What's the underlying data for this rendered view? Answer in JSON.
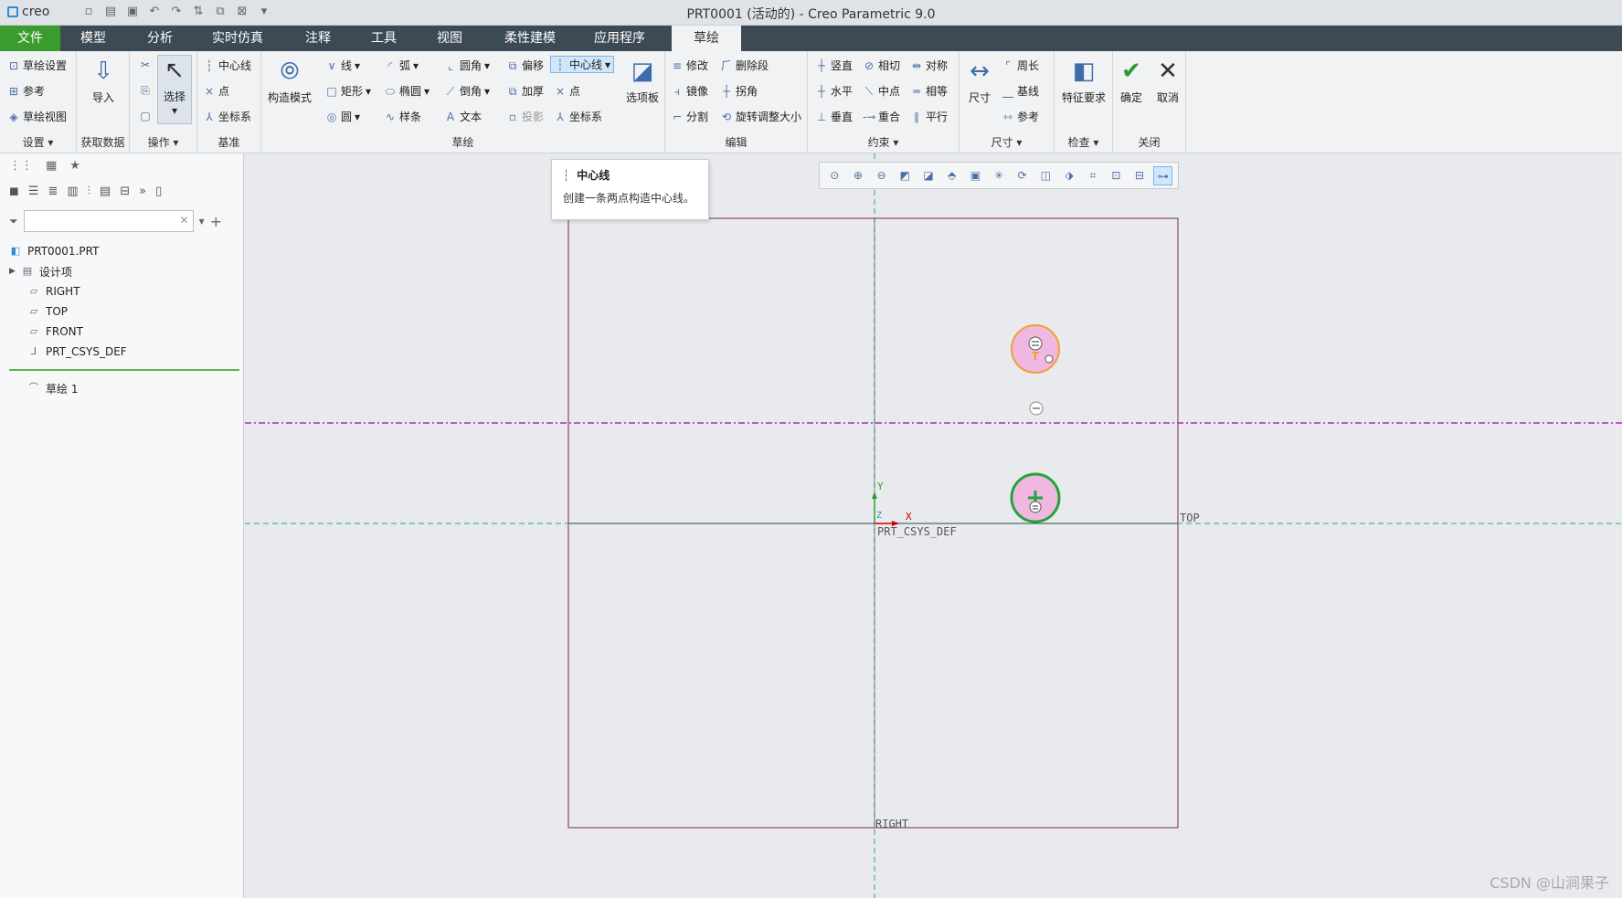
{
  "app": {
    "logo": "creo",
    "window_title": "PRT0001 (活动的) - Creo Parametric 9.0"
  },
  "menu": {
    "tabs": [
      "文件",
      "模型",
      "分析",
      "实时仿真",
      "注释",
      "工具",
      "视图",
      "柔性建模",
      "应用程序",
      "草绘"
    ],
    "active": "草绘"
  },
  "ribbon": {
    "setup": {
      "items": [
        "草绘设置",
        "参考",
        "草绘视图"
      ],
      "label": "设置"
    },
    "get_data": {
      "import": "导入",
      "label": "获取数据"
    },
    "operations": {
      "select": "选择",
      "label": "操作"
    },
    "datum": {
      "items": [
        "中心线",
        "点",
        "坐标系"
      ],
      "label": "基准"
    },
    "construction": {
      "label": "构造模式"
    },
    "sketch": {
      "col1": [
        "线",
        "矩形",
        "圆"
      ],
      "col2": [
        "弧",
        "椭圆",
        "样条"
      ],
      "col3": [
        "圆角",
        "倒角",
        "文本"
      ],
      "col4": [
        "偏移",
        "加厚",
        "投影"
      ],
      "col5": [
        "中心线",
        "点",
        "坐标系"
      ],
      "palette": "选项板",
      "label": "草绘"
    },
    "edit": {
      "items": [
        "修改",
        "删除段",
        "镜像",
        "拐角",
        "分割",
        "旋转调整大小"
      ],
      "label": "编辑"
    },
    "constrain": {
      "items": [
        "竖直",
        "相切",
        "对称",
        "水平",
        "中点",
        "相等",
        "垂直",
        "重合",
        "平行"
      ],
      "label": "约束"
    },
    "dimension": {
      "big": "尺寸",
      "items": [
        "周长",
        "基线",
        "参考"
      ],
      "label": "尺寸"
    },
    "inspect": {
      "big": "特征要求",
      "label": "检查"
    },
    "close": {
      "ok": "确定",
      "cancel": "取消",
      "label": "关闭"
    }
  },
  "tooltip": {
    "title": "中心线",
    "description": "创建一条两点构造中心线。"
  },
  "model_tree": {
    "root": "PRT0001.PRT",
    "items": [
      "设计项",
      "RIGHT",
      "TOP",
      "FRONT",
      "PRT_CSYS_DEF"
    ],
    "sketch": "草绘 1"
  },
  "canvas": {
    "labels": {
      "top": "TOP",
      "right": "RIGHT",
      "csys": "PRT_CSYS_DEF",
      "x_axis": "X",
      "y_axis": "Y",
      "z_axis": "Z"
    },
    "colors": {
      "centerline": "#b02bb4",
      "datum": "#1fa89a",
      "sketch_plane": "#7a2a3a",
      "circle_orange": "#f0a030",
      "circle_green": "#24a53c",
      "fill": "#f0b8e0"
    }
  },
  "watermark": "CSDN @山涧果子"
}
